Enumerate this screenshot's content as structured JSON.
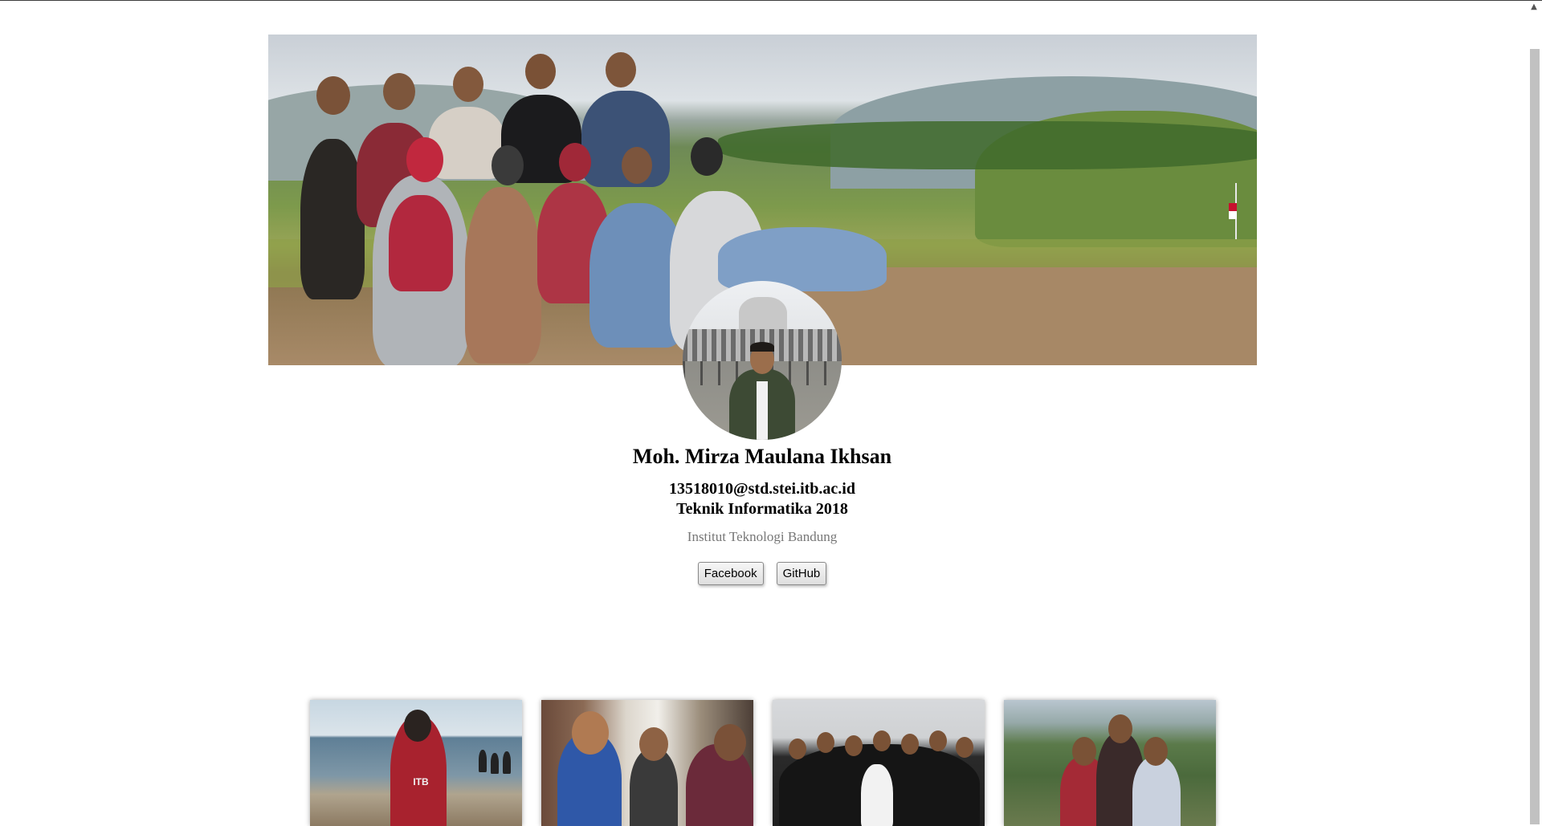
{
  "profile": {
    "name": "Moh. Mirza Maulana Ikhsan",
    "email": "13518010@std.stei.itb.ac.id",
    "major": "Teknik Informatika 2018",
    "institute": "Institut Teknologi Bandung"
  },
  "links": {
    "facebook_label": "Facebook",
    "github_label": "GitHub"
  },
  "gallery": {
    "photo1_text": "ITB"
  },
  "icons": {
    "scroll_up": "chevron-up-icon"
  }
}
